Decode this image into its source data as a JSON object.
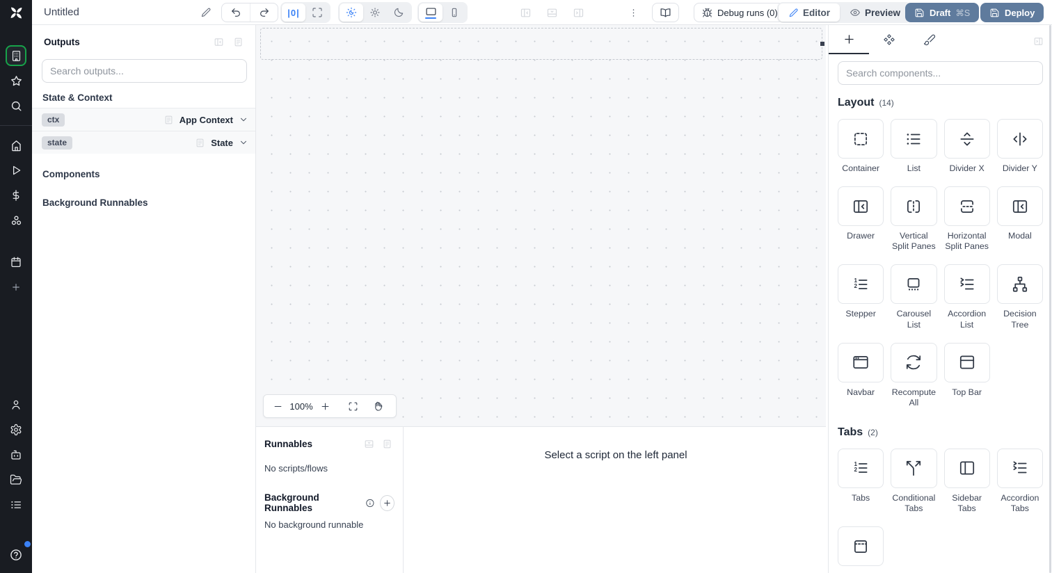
{
  "topbar": {
    "title": "Untitled",
    "zoom_reset": "|0|",
    "debug_runs": "Debug runs (0)",
    "editor": "Editor",
    "preview": "Preview",
    "draft": "Draft",
    "draft_shortcut": "⌘S",
    "deploy": "Deploy"
  },
  "outputs_panel": {
    "title": "Outputs",
    "search_placeholder": "Search outputs...",
    "state_context_header": "State & Context",
    "components_header": "Components",
    "background_runnables_header": "Background Runnables",
    "rows": [
      {
        "badge": "ctx",
        "type": "App Context"
      },
      {
        "badge": "state",
        "type": "State"
      }
    ]
  },
  "canvas": {
    "zoom_level": "100%"
  },
  "bottom_panel": {
    "runnables_title": "Runnables",
    "no_scripts": "No scripts/flows",
    "background_title": "Background Runnables",
    "no_background": "No background runnable",
    "select_hint": "Select a script on the left panel"
  },
  "components_panel": {
    "search_placeholder": "Search components...",
    "layout_title": "Layout",
    "layout_count": "(14)",
    "tabs_title": "Tabs",
    "tabs_count": "(2)",
    "layout_items": [
      "Container",
      "List",
      "Divider X",
      "Divider Y",
      "Drawer",
      "Vertical Split Panes",
      "Horizontal Split Panes",
      "Modal",
      "Stepper",
      "Carousel List",
      "Accordion List",
      "Decision Tree",
      "Navbar",
      "Recompute All",
      "Top Bar"
    ],
    "tabs_items": [
      "Tabs",
      "Conditional Tabs",
      "Sidebar Tabs",
      "Accordion Tabs"
    ]
  },
  "colors": {
    "accent": "#3b82f6",
    "primary_button": "#5f7b9d",
    "active_green": "#17a34a",
    "sidebar_bg": "#191c22"
  }
}
